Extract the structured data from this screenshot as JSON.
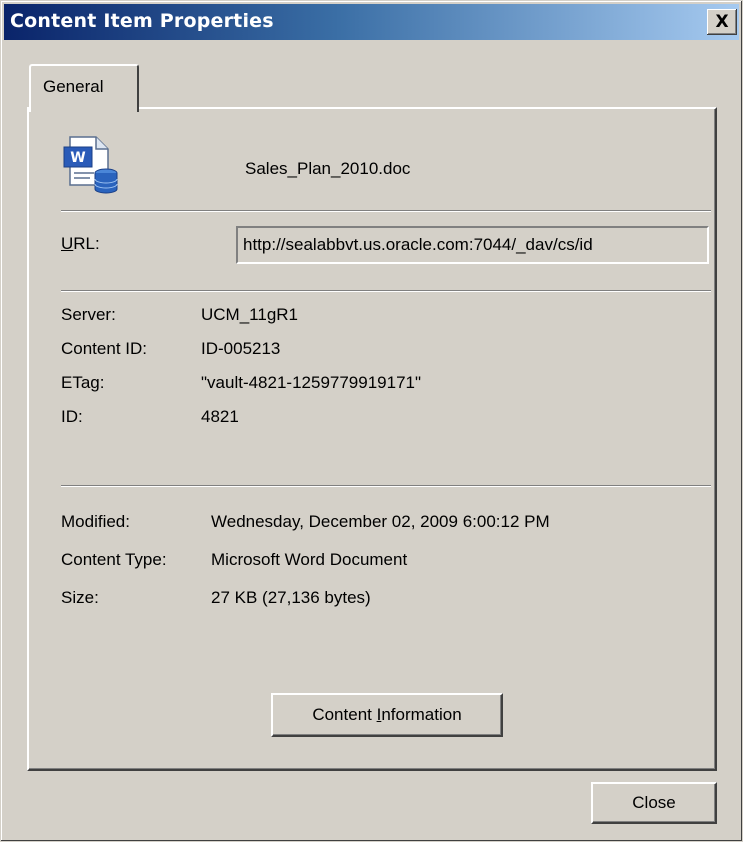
{
  "window": {
    "title": "Content Item Properties",
    "close_glyph": "X"
  },
  "tabs": [
    {
      "label": "General",
      "selected": true
    }
  ],
  "file": {
    "icon": "word-document-icon",
    "name": "Sales_Plan_2010.doc"
  },
  "url": {
    "label_accel": "U",
    "label_rest": "RL:",
    "value": "http://sealabbvt.us.oracle.com:7044/_dav/cs/id"
  },
  "details": {
    "server_label": "Server:",
    "server_value": "UCM_11gR1",
    "content_id_label": "Content ID:",
    "content_id_value": "ID-005213",
    "etag_label": "ETag:",
    "etag_value": "\"vault-4821-1259779919171\"",
    "id_label": "ID:",
    "id_value": "4821"
  },
  "meta": {
    "modified_label": "Modified:",
    "modified_value": "Wednesday, December 02, 2009 6:00:12 PM",
    "content_type_label": "Content Type:",
    "content_type_value": "Microsoft Word Document",
    "size_label": "Size:",
    "size_value": "27 KB (27,136 bytes)"
  },
  "buttons": {
    "content_info_pre": "Content ",
    "content_info_accel": "I",
    "content_info_post": "nformation",
    "close": "Close"
  },
  "colors": {
    "title_gradient_start": "#0a246a",
    "title_gradient_end": "#a6caf0",
    "face": "#d4d0c8"
  }
}
